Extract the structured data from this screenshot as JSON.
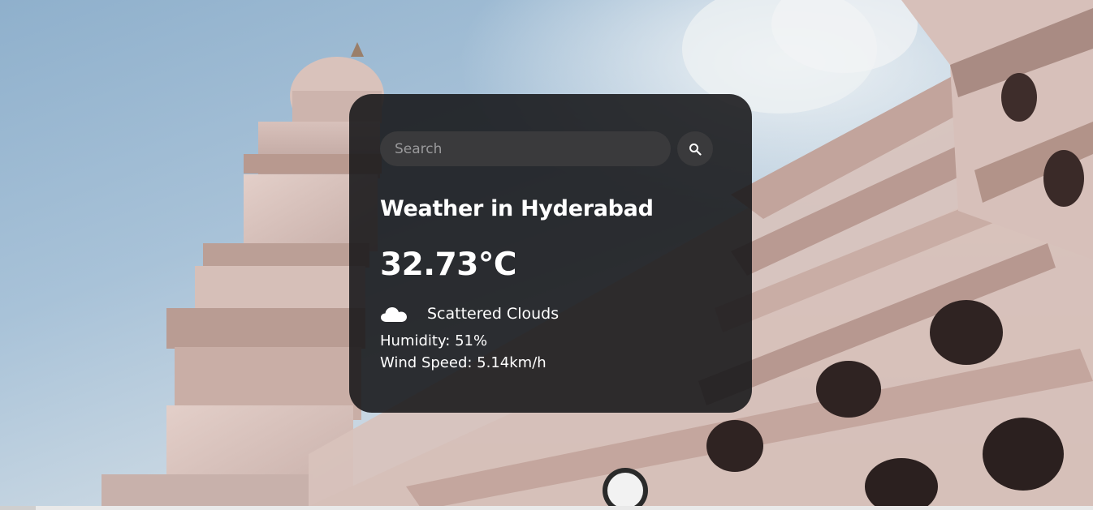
{
  "search": {
    "placeholder": "Search",
    "value": ""
  },
  "weather": {
    "city_heading": "Weather in Hyderabad",
    "temperature": "32.73°C",
    "description": "Scattered Clouds",
    "humidity": "Humidity: 51%",
    "wind": "Wind Speed: 5.14km/h",
    "icon": "cloud-icon"
  },
  "icons": {
    "search": "search-icon",
    "weather": "cloud-icon"
  },
  "background": {
    "subject": "background-photo",
    "colors": {
      "sky": "#a8c2d8",
      "stone": "#d9c4bf",
      "card": "#161618"
    }
  }
}
